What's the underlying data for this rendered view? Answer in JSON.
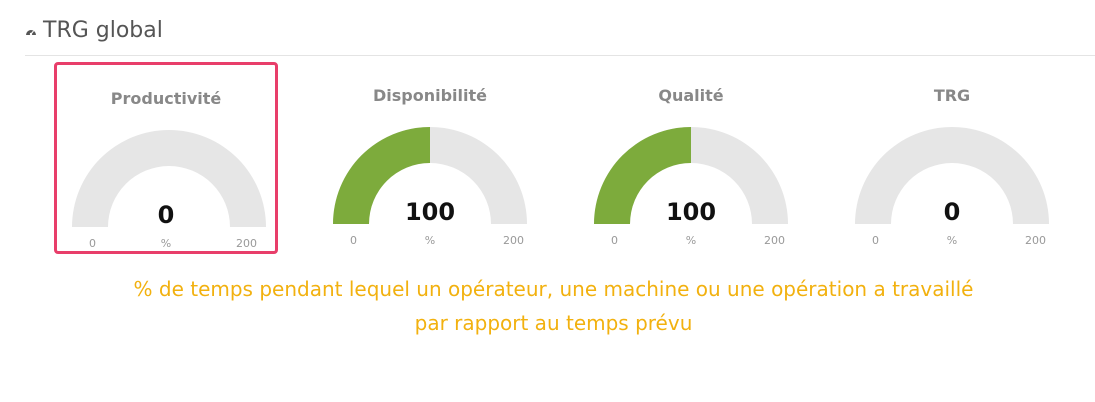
{
  "section": {
    "title": "TRG global",
    "icon": "dashboard-icon"
  },
  "colors": {
    "gauge_fill": "#7dab3c",
    "gauge_track": "#e6e6e6",
    "highlight_border": "#e83e6a",
    "description_text": "#f2b10f"
  },
  "gauges": [
    {
      "title": "Productivité",
      "value": "0",
      "value_num": 0,
      "min": "0",
      "max": "200",
      "max_num": 200,
      "unit": "%",
      "highlighted": true
    },
    {
      "title": "Disponibilité",
      "value": "100",
      "value_num": 100,
      "min": "0",
      "max": "200",
      "max_num": 200,
      "unit": "%",
      "highlighted": false
    },
    {
      "title": "Qualité",
      "value": "100",
      "value_num": 100,
      "min": "0",
      "max": "200",
      "max_num": 200,
      "unit": "%",
      "highlighted": false
    },
    {
      "title": "TRG",
      "value": "0",
      "value_num": 0,
      "min": "0",
      "max": "200",
      "max_num": 200,
      "unit": "%",
      "highlighted": false
    }
  ],
  "description": {
    "line1": "% de temps pendant lequel un opérateur, une machine ou une opération a travaillé",
    "line2": "par rapport au temps prévu"
  }
}
